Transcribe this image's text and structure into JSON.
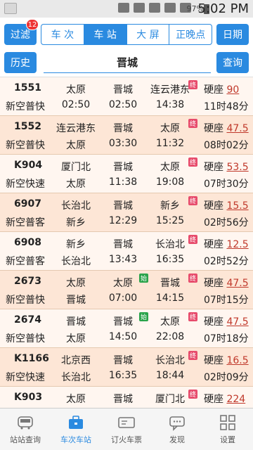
{
  "status": {
    "battery": "97%",
    "time": "5:02 PM"
  },
  "toolbar": {
    "filter_label": "过滤",
    "filter_badge": "12",
    "tabs": [
      {
        "label": "车 次",
        "active": false
      },
      {
        "label": "车 站",
        "active": true
      },
      {
        "label": "大 屏",
        "active": false
      },
      {
        "label": "正晚点",
        "active": false
      }
    ],
    "date_label": "日期"
  },
  "search": {
    "history_label": "历史",
    "station": "晋城",
    "query_label": "查询"
  },
  "trains": [
    {
      "no": "1551",
      "type": "新空普快",
      "from": "太原",
      "from_time": "02:50",
      "st": "晋城",
      "st_time": "02:50",
      "to": "连云港东",
      "to_time": "14:38",
      "seat": "硬座",
      "price": "90",
      "duration": "11时48分",
      "to_tag": "end",
      "st_tag": ""
    },
    {
      "no": "1552",
      "type": "新空普快",
      "from": "连云港东",
      "from_time": "太原",
      "st": "晋城",
      "st_time": "03:30",
      "to": "太原",
      "to_time": "11:32",
      "seat": "硬座",
      "price": "47.5",
      "duration": "08时02分",
      "to_tag": "end",
      "st_tag": ""
    },
    {
      "no": "K904",
      "type": "新空快速",
      "from": "厦门北",
      "from_time": "太原",
      "st": "晋城",
      "st_time": "11:38",
      "to": "太原",
      "to_time": "19:08",
      "seat": "硬座",
      "price": "53.5",
      "duration": "07时30分",
      "to_tag": "end",
      "st_tag": ""
    },
    {
      "no": "6907",
      "type": "新空普客",
      "from": "长治北",
      "from_time": "新乡",
      "st": "晋城",
      "st_time": "12:29",
      "to": "新乡",
      "to_time": "15:25",
      "seat": "硬座",
      "price": "15.5",
      "duration": "02时56分",
      "to_tag": "end",
      "st_tag": ""
    },
    {
      "no": "6908",
      "type": "新空普客",
      "from": "新乡",
      "from_time": "长治北",
      "st": "晋城",
      "st_time": "13:43",
      "to": "长治北",
      "to_time": "16:35",
      "seat": "硬座",
      "price": "12.5",
      "duration": "02时52分",
      "to_tag": "end",
      "st_tag": ""
    },
    {
      "no": "2673",
      "type": "新空普快",
      "from": "太原",
      "from_time": "晋城",
      "st": "太原",
      "st_time": "07:00",
      "to": "晋城",
      "to_time": "14:15",
      "seat": "硬座",
      "price": "47.5",
      "duration": "07时15分",
      "to_tag": "end",
      "st_tag": "start"
    },
    {
      "no": "2674",
      "type": "新空普快",
      "from": "晋城",
      "from_time": "太原",
      "st": "晋城",
      "st_time": "14:50",
      "to": "太原",
      "to_time": "22:08",
      "seat": "硬座",
      "price": "47.5",
      "duration": "07时18分",
      "to_tag": "end",
      "st_tag": "start"
    },
    {
      "no": "K1166",
      "type": "新空快速",
      "from": "北京西",
      "from_time": "长治北",
      "st": "晋城",
      "st_time": "16:35",
      "to": "长治北",
      "to_time": "18:44",
      "seat": "硬座",
      "price": "16.5",
      "duration": "02时09分",
      "to_tag": "end",
      "st_tag": ""
    },
    {
      "no": "K903",
      "type": "",
      "from": "太原",
      "from_time": "",
      "st": "晋城",
      "st_time": "",
      "to": "厦门北",
      "to_time": "",
      "seat": "硬座",
      "price": "224",
      "duration": "",
      "to_tag": "end",
      "st_tag": ""
    }
  ],
  "nav": [
    {
      "label": "站站查询",
      "icon": "train-icon",
      "active": false
    },
    {
      "label": "车次车站",
      "icon": "briefcase-icon",
      "active": true
    },
    {
      "label": "订火车票",
      "icon": "ticket-icon",
      "active": false
    },
    {
      "label": "发现",
      "icon": "chat-icon",
      "active": false
    },
    {
      "label": "设置",
      "icon": "settings-grid-icon",
      "active": false
    }
  ],
  "colors": {
    "accent": "#2a8ae0",
    "price": "#c0392b",
    "end_tag": "#e74c6c",
    "start_tag": "#29a34a"
  }
}
